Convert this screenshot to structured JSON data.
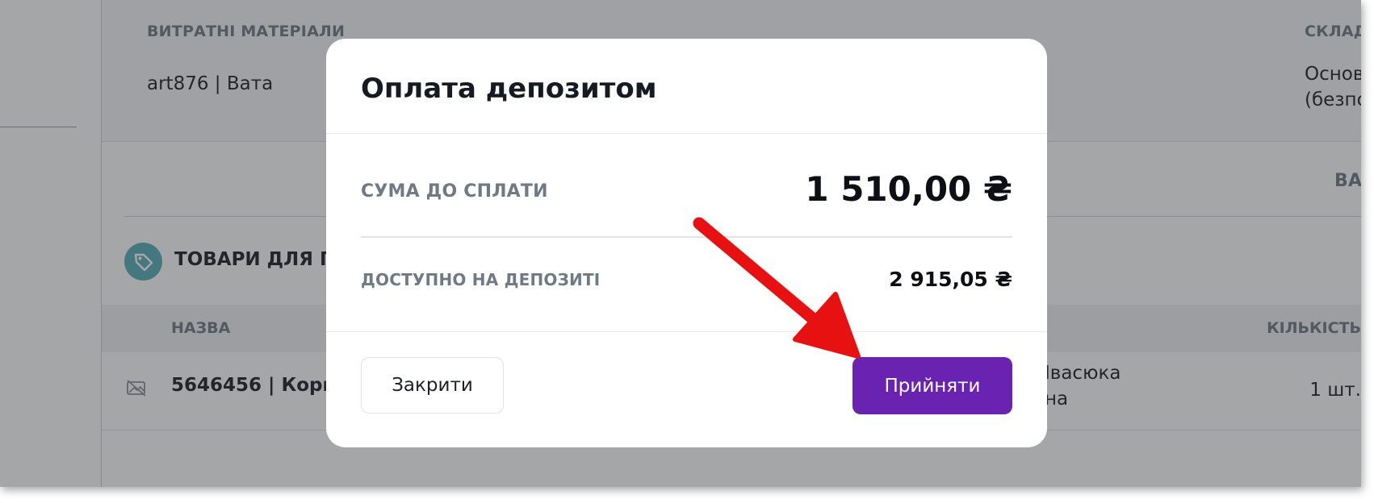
{
  "background": {
    "top_section": {
      "consumables_label": "ВИТРАТНІ МАТЕРІАЛИ",
      "consumables_item": "art876 | Вата",
      "warehouse_label": "СКЛАД",
      "warehouse_line1": "Основ",
      "warehouse_line2": "(безпо"
    },
    "right_cut_label": "ВА",
    "products_section": {
      "title": "ТОВАРИ ДЛЯ П"
    },
    "table": {
      "headers": {
        "name": "НАЗВА",
        "quantity": "КІЛЬКІСТЬ"
      },
      "rows": [
        {
          "name": "5646456 | Корм",
          "warehouse_line1": "Івасюка",
          "warehouse_line2": "на",
          "quantity": "1 шт."
        }
      ]
    }
  },
  "modal": {
    "title": "Оплата депозитом",
    "sum_label": "СУМА ДО СПЛАТИ",
    "sum_value": "1 510,00 ₴",
    "deposit_label": "ДОСТУПНО НА ДЕПОЗИТІ",
    "deposit_value": "2 915,05 ₴",
    "close_button": "Закрити",
    "accept_button": "Прийняти"
  },
  "colors": {
    "accent": "#6a22b0",
    "annotation_arrow": "#e81111",
    "section_icon": "#5aaeb8"
  },
  "icons": {
    "section": "tag-icon",
    "row": "no-image-icon"
  }
}
